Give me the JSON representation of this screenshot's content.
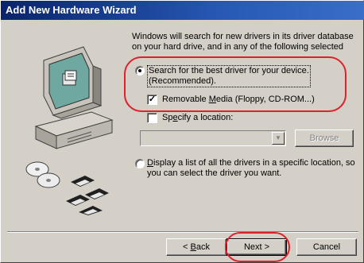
{
  "window": {
    "title": "Add New Hardware Wizard"
  },
  "intro_text": "Windows will search for new drivers in its driver database on your hard drive, and in any of the following selected",
  "options": {
    "search_best": {
      "label_line1": "Search for the best driver for your device.",
      "label_line2": "(Recommended).",
      "checked": true
    },
    "removable_media": {
      "label_prefix": "Removable ",
      "label_accel": "M",
      "label_suffix": "edia (Floppy, CD-ROM...)",
      "checked": true
    },
    "specify_location": {
      "label_prefix": "Sp",
      "label_accel": "e",
      "label_suffix": "cify a location:",
      "checked": false
    },
    "location_combo": {
      "value": "",
      "enabled": false
    },
    "browse_label": "Browse",
    "display_list": {
      "label_accel": "D",
      "label_line1_suffix": "isplay a list of all the drivers in a specific location, so",
      "label_line2": "you can select the driver you want.",
      "checked": false
    }
  },
  "buttons": {
    "back_prefix": "< ",
    "back_accel": "B",
    "back_suffix": "ack",
    "next_label": "Next >",
    "cancel_label": "Cancel"
  },
  "colors": {
    "title_bg": "#0a246a",
    "annotation": "#e0202c",
    "face": "#d4d0c8"
  }
}
